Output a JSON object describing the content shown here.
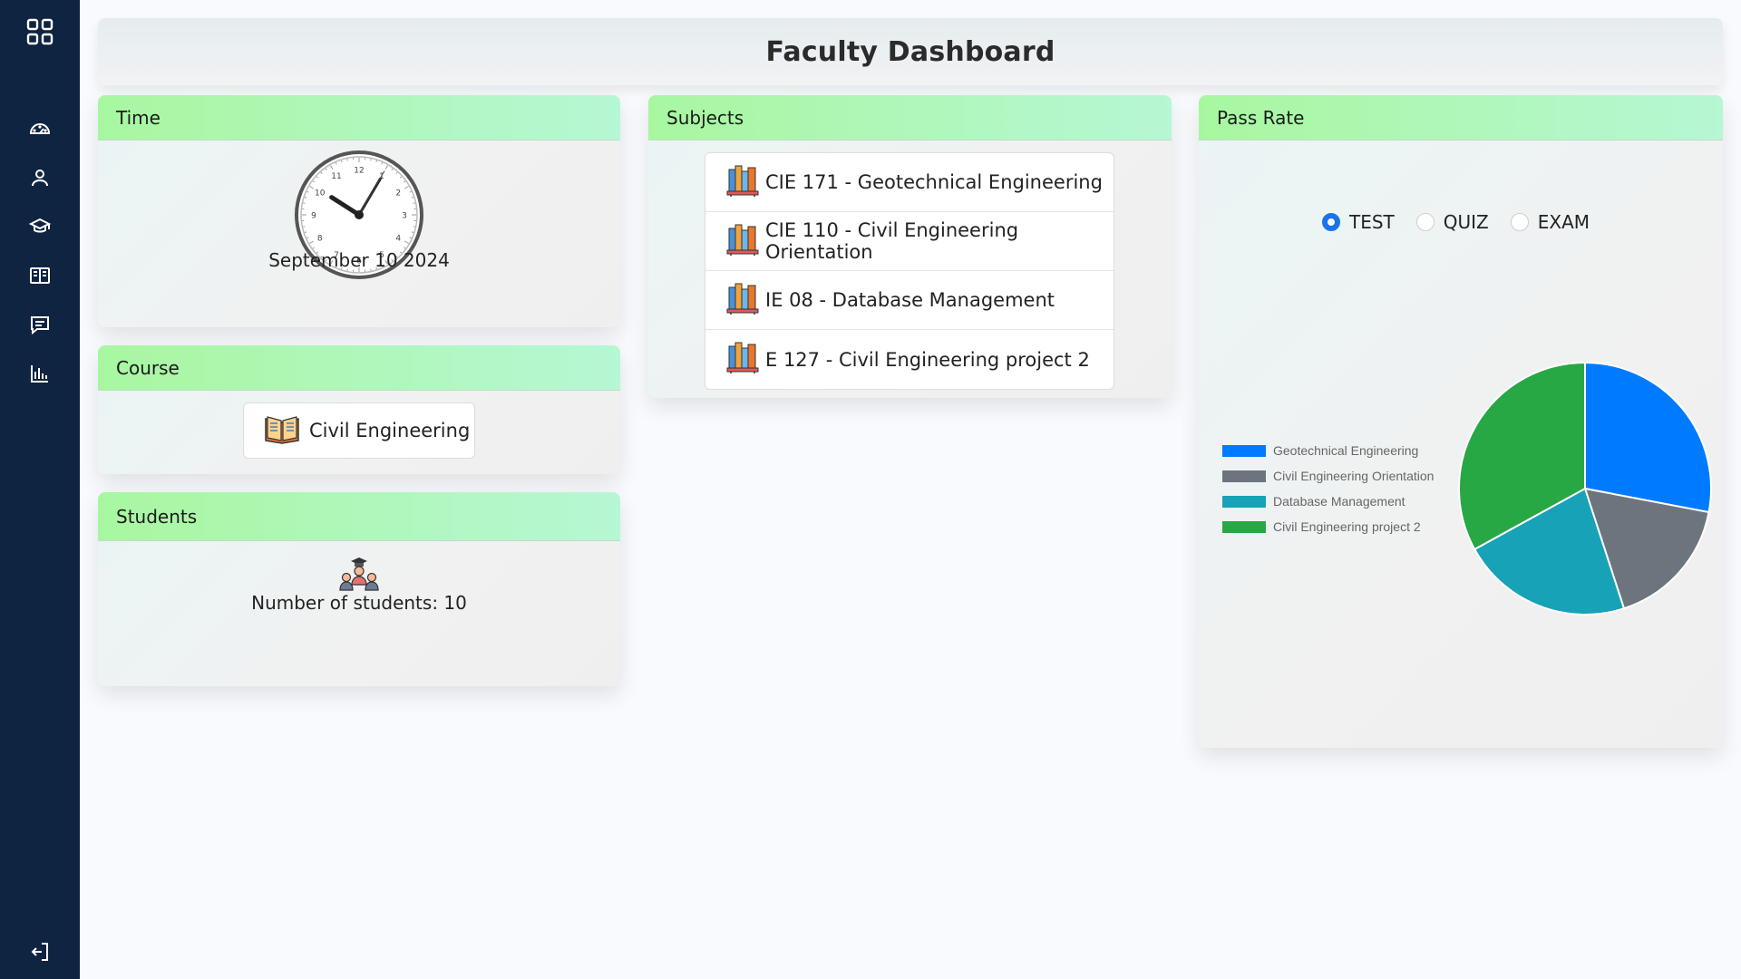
{
  "header": {
    "title": "Faculty Dashboard"
  },
  "sidebar": {
    "items": [
      "apps-grid-icon",
      "dashboard-gauge-icon",
      "user-icon",
      "graduation-cap-icon",
      "book-open-icon",
      "message-icon",
      "bar-chart-icon",
      "logout-icon"
    ]
  },
  "time_card": {
    "title": "Time",
    "date": "September 10 2024",
    "clock": {
      "hour": 10,
      "minute": 5,
      "second": 5,
      "numerals": [
        "12",
        "1",
        "2",
        "3",
        "4",
        "5",
        "6",
        "7",
        "8",
        "9",
        "10",
        "11"
      ]
    }
  },
  "course_card": {
    "title": "Course",
    "course": "Civil Engineering",
    "icon": "open-book-icon"
  },
  "students_card": {
    "title": "Students",
    "count_text": "Number of students: 10",
    "icon": "students-group-icon"
  },
  "subjects_card": {
    "title": "Subjects",
    "items": [
      {
        "label": "CIE 171 - Geotechnical Engineering"
      },
      {
        "label": "CIE 110 - Civil Engineering Orientation"
      },
      {
        "label": "IE 08 - Database Management"
      },
      {
        "label": "E 127 - Civil Engineering project 2"
      }
    ],
    "icon": "books-shelf-icon"
  },
  "pass_rate_card": {
    "title": "Pass Rate",
    "options": [
      {
        "label": "TEST",
        "selected": true
      },
      {
        "label": "QUIZ",
        "selected": false
      },
      {
        "label": "EXAM",
        "selected": false
      }
    ]
  },
  "chart_data": {
    "type": "pie",
    "series": [
      {
        "name": "Geotechnical Engineering",
        "value": 28,
        "color": "#007bff"
      },
      {
        "name": "Civil Engineering Orientation",
        "value": 17,
        "color": "#6c757d"
      },
      {
        "name": "Database Management",
        "value": 22,
        "color": "#17a2b8"
      },
      {
        "name": "Civil Engineering project 2",
        "value": 33,
        "color": "#28a745"
      }
    ],
    "legend_position": "left"
  }
}
